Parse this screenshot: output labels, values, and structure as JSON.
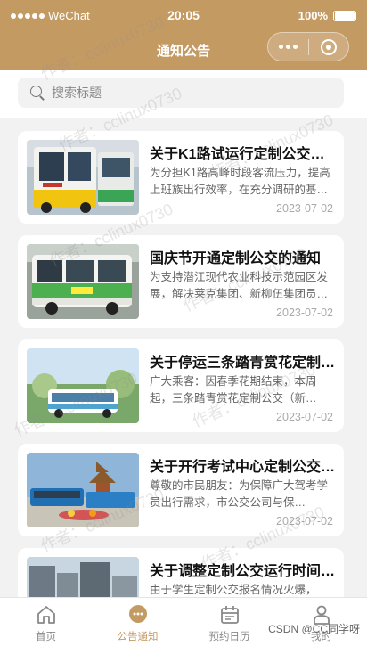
{
  "status_bar": {
    "carrier": "WeChat",
    "time": "20:05",
    "battery": "100%"
  },
  "nav": {
    "title": "通知公告"
  },
  "search": {
    "placeholder": "搜索标题"
  },
  "notices": [
    {
      "title": "关于K1路试运行定制公交的通知",
      "desc": "为分担K1路高峰时段客流压力，提高上班族出行效率，在充分调研的基础上",
      "date": "2023-07-02",
      "image": "bus-yellow-icon"
    },
    {
      "title": "国庆节开通定制公交的通知",
      "desc": "为支持潜江现代农业科技示范园区发展，解决莱克集团、新柳伍集团员工出行",
      "date": "2023-07-02",
      "image": "bus-green-icon"
    },
    {
      "title": "关于停运三条踏青赏花定制公交的通知",
      "desc": "广大乘客：因春季花期结束，本周起，三条踏青赏花定制公交（新…",
      "date": "2023-07-02",
      "image": "bus-spring-icon"
    },
    {
      "title": "关于开行考试中心定制公交的通知",
      "desc": "尊敬的市民朋友：为保障广大驾考学员出行需求，市公交公司与保…",
      "date": "2023-07-02",
      "image": "bus-plaza-icon"
    },
    {
      "title": "关于调整定制公交运行时间的通知",
      "desc": "由于学生定制公交报名情况火爆，",
      "date": "",
      "image": "bus-city-icon"
    }
  ],
  "tabs": [
    {
      "label": "首页",
      "icon": "home-icon",
      "active": false
    },
    {
      "label": "公告通知",
      "icon": "chat-bubble-icon",
      "active": true
    },
    {
      "label": "预约日历",
      "icon": "calendar-icon",
      "active": false
    },
    {
      "label": "我的",
      "icon": "user-icon",
      "active": false
    }
  ],
  "watermark": {
    "text": "作者：cclinux0730",
    "footer": "CSDN @CC同学呀"
  },
  "colors": {
    "brand": "#c49a63",
    "background": "#f2f2f2"
  }
}
